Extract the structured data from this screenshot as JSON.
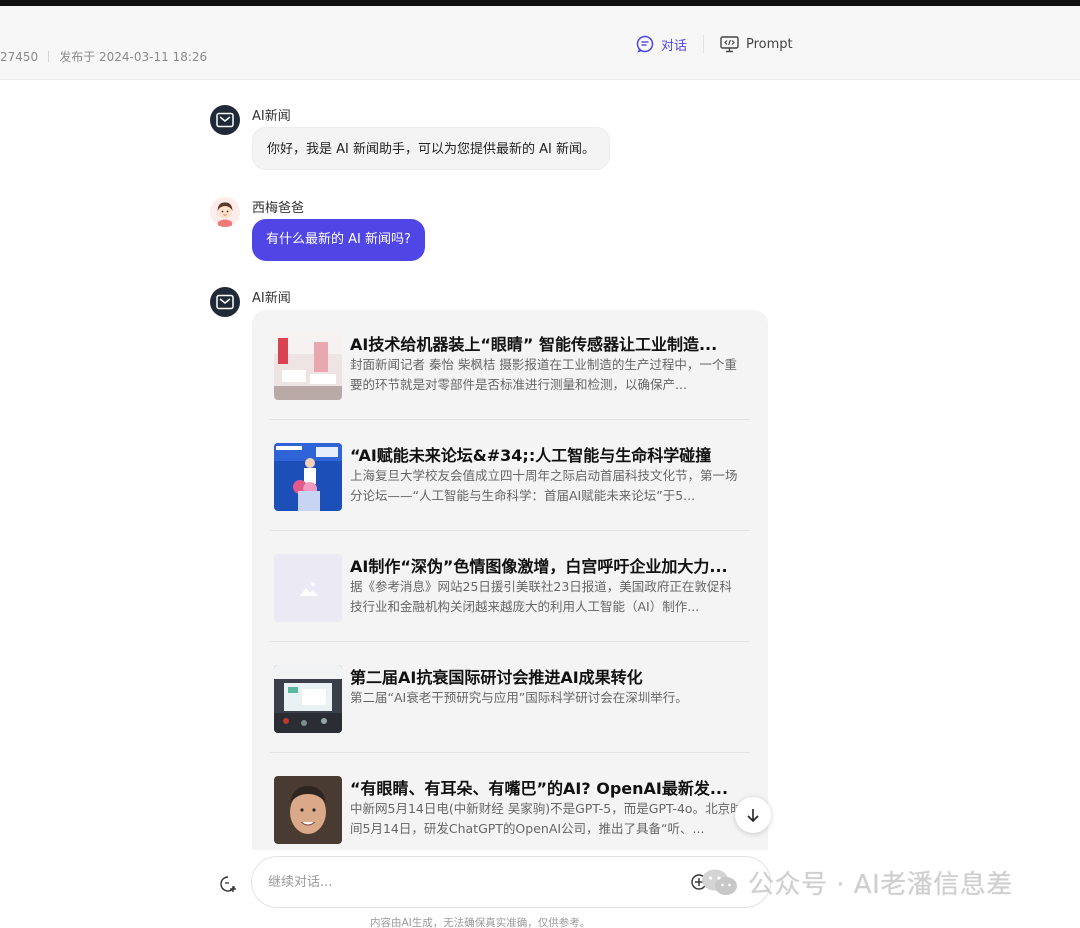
{
  "header": {
    "id_fragment": "27450",
    "published": "发布于 2024-03-11 18:26",
    "tabs": [
      {
        "label": "对话",
        "icon": "chat-icon",
        "active": true
      },
      {
        "label": "Prompt",
        "icon": "prompt-icon",
        "active": false
      }
    ]
  },
  "messages": [
    {
      "sender": "AI新闻",
      "role": "bot",
      "text": "你好，我是 AI 新闻助手，可以为您提供最新的 AI 新闻。"
    },
    {
      "sender": "西梅爸爸",
      "role": "user",
      "text": "有什么最新的 AI 新闻吗?"
    },
    {
      "sender": "AI新闻",
      "role": "bot"
    }
  ],
  "news": [
    {
      "title": "AI技术给机器装上“眼睛” 智能传感器让工业制造...",
      "desc": "封面新闻记者 秦怡 柴枫桔 摄影报道在工业制造的生产过程中，一个重要的环节就是对零部件是否标准进行测量和检测，以确保产..."
    },
    {
      "title": "“AI赋能未来论坛&#34;:人工智能与生命科学碰撞",
      "desc": "上海复旦大学校友会值成立四十周年之际启动首届科技文化节，第一场分论坛——“人工智能与生命科学：首届AI赋能未来论坛”于5..."
    },
    {
      "title": "AI制作“深伪”色情图像激增，白宫呼吁企业加大力...",
      "desc": "据《参考消息》网站25日援引美联社23日报道，美国政府正在敦促科技行业和金融机构关闭越来越庞大的利用人工智能（AI）制作..."
    },
    {
      "title": "第二届AI抗衰国际研讨会推进AI成果转化",
      "desc": "第二届“AI衰老干预研究与应用”国际科学研讨会在深圳举行。"
    },
    {
      "title": "“有眼睛、有耳朵、有嘴巴”的AI? OpenAI最新发...",
      "desc": "中新网5月14日电(中新财经 吴家驹)不是GPT-5，而是GPT-4o。北京时间5月14日，研发ChatGPT的OpenAI公司，推出了具备“听、..."
    }
  ],
  "input": {
    "placeholder": "继续对话..."
  },
  "disclaimer": "内容由AI生成，无法确保真实准确，仅供参考。",
  "watermark": "公众号 · AI老潘信息差",
  "colors": {
    "accent": "#4f46e5",
    "bot_avatar": "#1f2937",
    "card_bg": "#f4f4f5"
  }
}
